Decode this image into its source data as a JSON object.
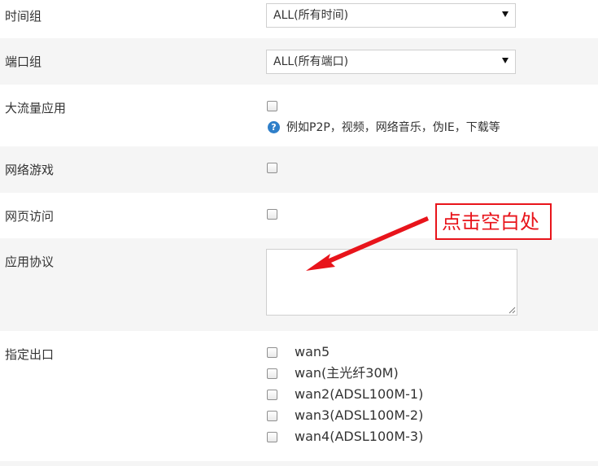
{
  "form": {
    "time_group": {
      "label": "时间组",
      "selected": "ALL(所有时间)"
    },
    "port_group": {
      "label": "端口组",
      "selected": "ALL(所有端口)"
    },
    "heavy_traffic": {
      "label": "大流量应用",
      "checked": false,
      "hint": "例如P2P，视频，网络音乐，伪IE，下载等"
    },
    "online_games": {
      "label": "网络游戏",
      "checked": false
    },
    "web_access": {
      "label": "网页访问",
      "checked": false
    },
    "app_protocol": {
      "label": "应用协议",
      "value": ""
    },
    "outbound": {
      "label": "指定出口",
      "options": [
        {
          "label": "wan5",
          "checked": false
        },
        {
          "label": "wan(主光纤30M)",
          "checked": false
        },
        {
          "label": "wan2(ADSL100M-1)",
          "checked": false
        },
        {
          "label": "wan3(ADSL100M-2)",
          "checked": false
        },
        {
          "label": "wan4(ADSL100M-3)",
          "checked": false
        }
      ]
    }
  },
  "annotation": {
    "text": "点击空白处",
    "color": "#e8141b"
  },
  "icons": {
    "help": "question-circle-icon",
    "dropdown": "caret-down-icon"
  },
  "colors": {
    "row_shade": "#f5f5f5",
    "help_icon": "#2f7fc9",
    "annotation_red": "#e8141b"
  }
}
